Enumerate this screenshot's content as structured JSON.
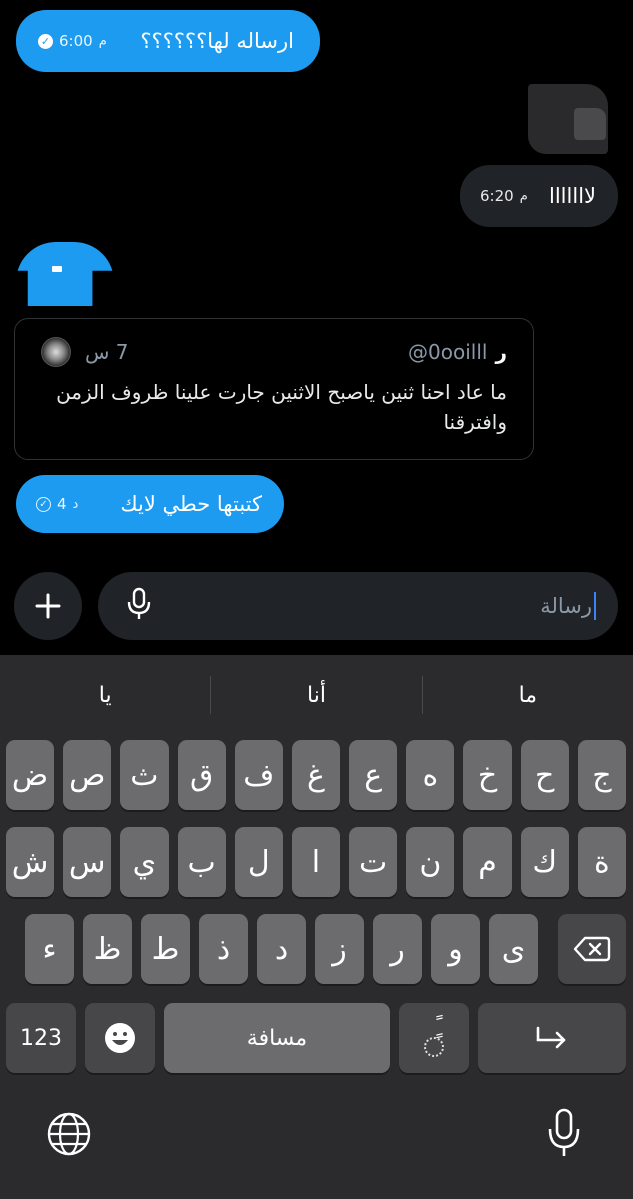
{
  "messages": {
    "m1": {
      "text": "ارساله لها؟؟؟؟؟؟",
      "time": "6:00",
      "ampm": "م"
    },
    "m2": {
      "text": "لااااااا",
      "time": "6:20",
      "ampm": "م"
    },
    "m3": {
      "text": "كتبتها حطي لايك",
      "time": "4",
      "ampm": "د"
    }
  },
  "quoted_tweet": {
    "name": "ر",
    "handle": "@0ooilll",
    "time": "7 س",
    "text": "ما عاد احنا ثنين ياصبح الاثنين جارت علينا ظروف الزمن وافترقنا"
  },
  "composer": {
    "placeholder": "رسالة"
  },
  "keyboard": {
    "suggestions": [
      "ما",
      "أنا",
      "يا"
    ],
    "row1": [
      "ج",
      "ح",
      "خ",
      "ه",
      "ع",
      "غ",
      "ف",
      "ق",
      "ث",
      "ص",
      "ض"
    ],
    "row2": [
      "ة",
      "ك",
      "م",
      "ن",
      "ت",
      "ا",
      "ل",
      "ب",
      "ي",
      "س",
      "ش"
    ],
    "row3": [
      "ى",
      "و",
      "ر",
      "ز",
      "د",
      "ذ",
      "ط",
      "ظ",
      "ء"
    ],
    "numbers_label": "123",
    "space_label": "مسافة",
    "diacritic_label": "ًٍ"
  },
  "colors": {
    "accent": "#1d9bf0",
    "bubble_gray": "#202327",
    "keyboard_bg": "#2b2b2d",
    "key": "#6c6c6e"
  }
}
